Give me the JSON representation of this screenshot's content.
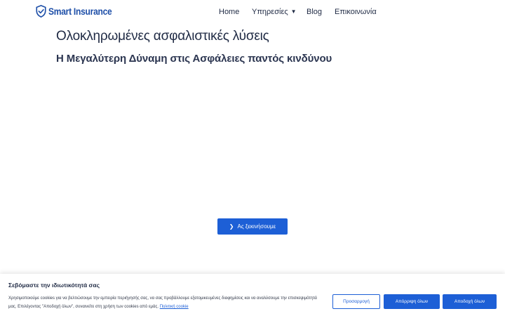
{
  "brand": {
    "logo_text": "Smart Insurance",
    "color": "#1e4fa8"
  },
  "nav": {
    "home": "Home",
    "services": "Υπηρεσίες",
    "blog": "Blog",
    "contact": "Επικοινωνία"
  },
  "hero": {
    "title": "Ολοκληρωμένες ασφαλιστικές λύσεις",
    "subtitle": "Η Μεγαλύτερη Δύναμη στις Ασφάλειες παντός κινδύνου",
    "cta_label": "Ας ξεκινήσουμε"
  },
  "cookie_banner": {
    "title": "Σεβόμαστε την ιδιωτικότητά σας",
    "text": "Χρησιμοποιούμε cookies για να βελτιώσουμε την εμπειρία περιήγησής σας, να σας προβάλλουμε εξατομικευμένες διαφημίσεις και να αναλύσουμε την επισκεψιμότητά μας. Επιλέγοντας \"Αποδοχή όλων\", συναινείτε στη χρήση των cookies από εμάς.",
    "policy_link": "Πολιτική cookie",
    "customize_label": "Προσαρμογή",
    "reject_label": "Απόρριψη όλων",
    "accept_label": "Αποδοχή όλων"
  },
  "colors": {
    "accent": "#1d5fd6",
    "text": "#1f2a44"
  },
  "icons": {
    "logo": "shield-check-icon",
    "services_dropdown": "chevron-down-icon",
    "cta": "chevron-right-icon"
  }
}
